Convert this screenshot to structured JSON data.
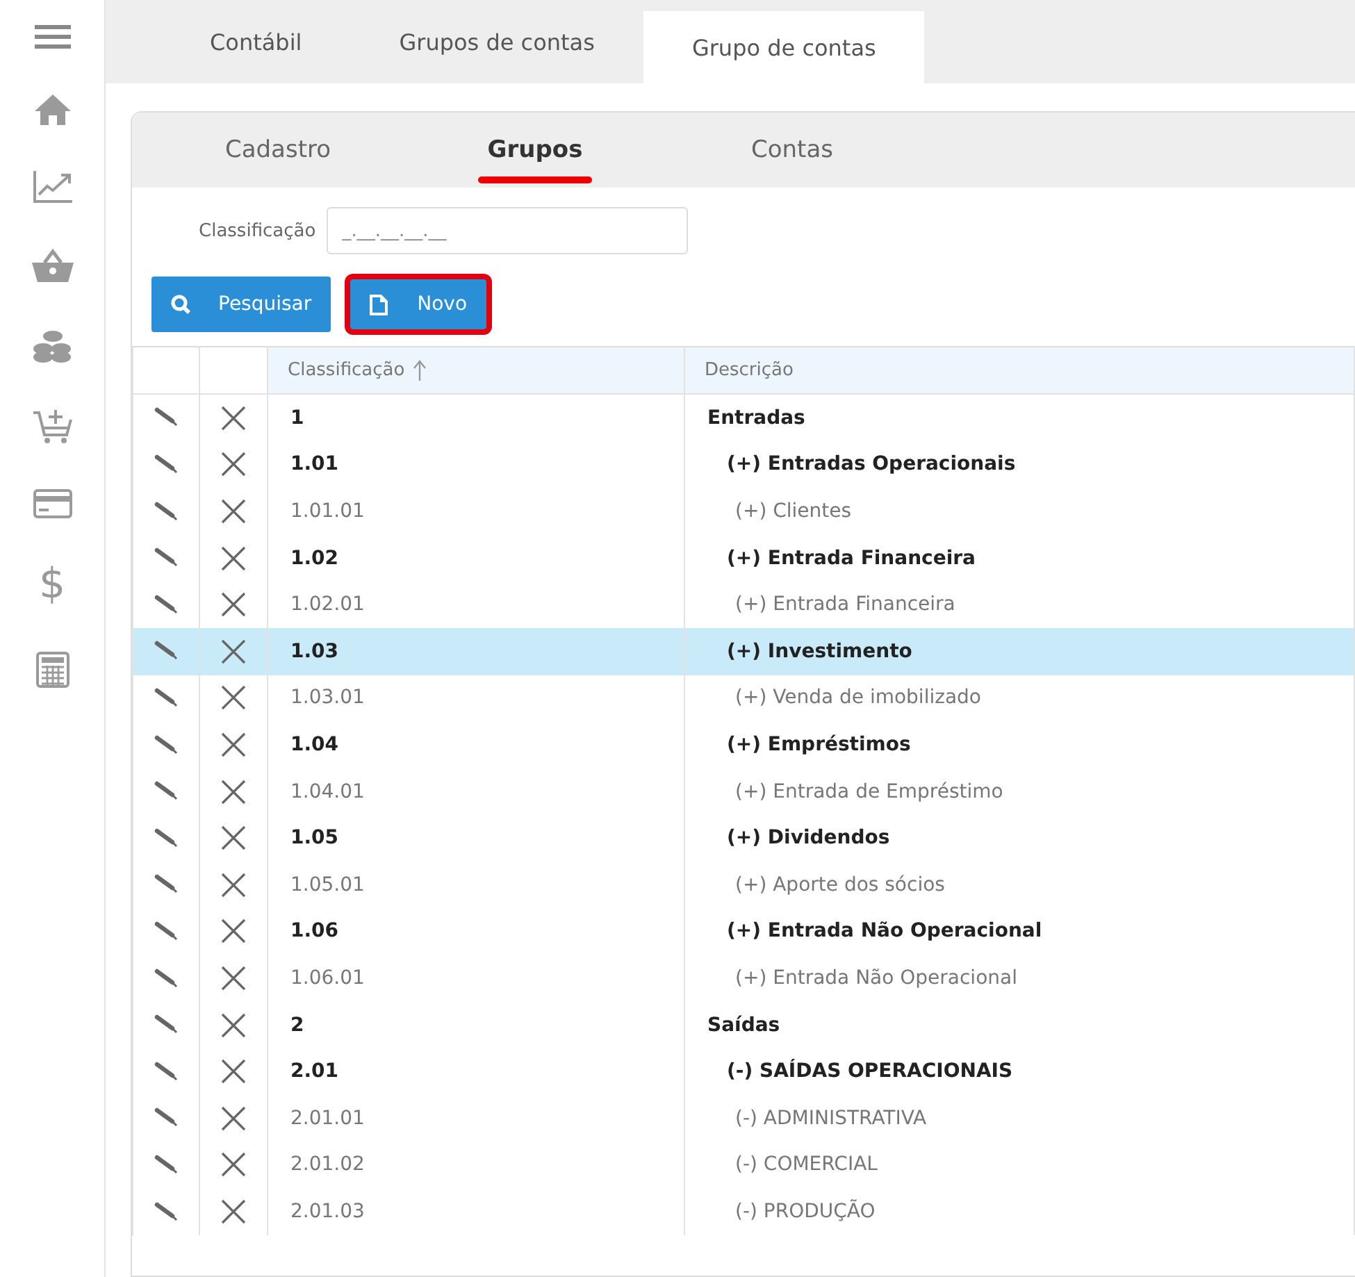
{
  "sidebar": {
    "items": [
      {
        "kind": "menu"
      },
      {
        "kind": "home"
      },
      {
        "kind": "chart"
      },
      {
        "kind": "basket"
      },
      {
        "kind": "coins"
      },
      {
        "kind": "cart-plus"
      },
      {
        "kind": "card"
      },
      {
        "kind": "glyph",
        "text": "$"
      },
      {
        "kind": "calculator"
      }
    ]
  },
  "tabs": [
    {
      "label": "Contábil",
      "selected": false
    },
    {
      "label": "Grupos de contas",
      "selected": false
    },
    {
      "label": "Grupo de contas",
      "selected": true
    }
  ],
  "subtabs": [
    {
      "label": "Cadastro",
      "selected": false
    },
    {
      "label": "Grupos",
      "selected": true
    },
    {
      "label": "Contas",
      "selected": false
    }
  ],
  "filter": {
    "label": "Classificação",
    "placeholder": "_.__.__.__.__"
  },
  "buttons": [
    {
      "kind": "search",
      "label": "Pesquisar",
      "highlighted": false
    },
    {
      "kind": "new",
      "label": "Novo",
      "highlighted": true
    }
  ],
  "table": {
    "columns": [
      {
        "label": "Classificação",
        "sorted": true
      },
      {
        "label": "Descrição",
        "sorted": false
      }
    ],
    "rows": [
      {
        "code": "1",
        "description": "Entradas",
        "selected": false,
        "children": [
          {
            "code": "1.01",
            "description": "(+) Entradas Operacionais",
            "selected": false,
            "children": [
              {
                "code": "1.01.01",
                "description": "(+) Clientes",
                "selected": false
              }
            ]
          },
          {
            "code": "1.02",
            "description": "(+) Entrada Financeira",
            "selected": false,
            "children": [
              {
                "code": "1.02.01",
                "description": "(+) Entrada Financeira",
                "selected": false
              }
            ]
          },
          {
            "code": "1.03",
            "description": "(+) Investimento",
            "selected": true,
            "children": [
              {
                "code": "1.03.01",
                "description": "(+) Venda de imobilizado",
                "selected": false
              }
            ]
          },
          {
            "code": "1.04",
            "description": "(+) Empréstimos",
            "selected": false,
            "children": [
              {
                "code": "1.04.01",
                "description": "(+) Entrada de Empréstimo",
                "selected": false
              }
            ]
          },
          {
            "code": "1.05",
            "description": "(+) Dividendos",
            "selected": false,
            "children": [
              {
                "code": "1.05.01",
                "description": "(+) Aporte dos sócios",
                "selected": false
              }
            ]
          },
          {
            "code": "1.06",
            "description": "(+) Entrada Não Operacional",
            "selected": false,
            "children": [
              {
                "code": "1.06.01",
                "description": "(+) Entrada Não Operacional",
                "selected": false
              }
            ]
          }
        ]
      },
      {
        "code": "2",
        "description": "Saídas",
        "selected": false,
        "children": [
          {
            "code": "2.01",
            "description": "(-) SAÍDAS OPERACIONAIS",
            "selected": false,
            "children": [
              {
                "code": "2.01.01",
                "description": "(-) ADMINISTRATIVA",
                "selected": false
              },
              {
                "code": "2.01.02",
                "description": "(-) COMERCIAL",
                "selected": false
              },
              {
                "code": "2.01.03",
                "description": "(-) PRODUÇÃO",
                "selected": false
              }
            ]
          }
        ]
      }
    ]
  }
}
